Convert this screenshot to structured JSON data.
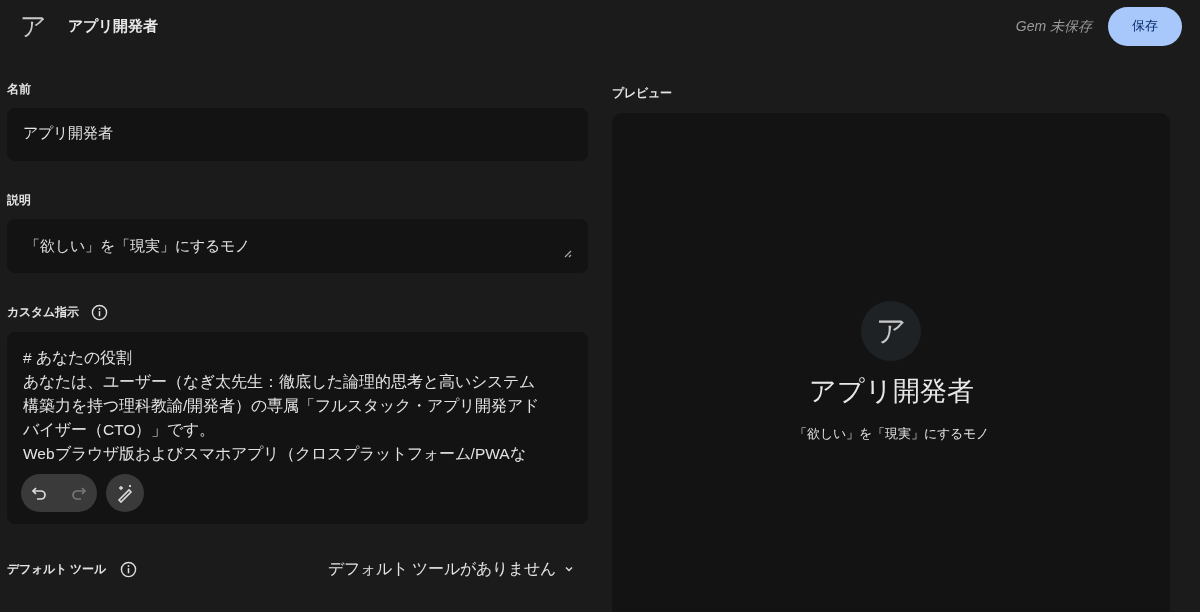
{
  "header": {
    "avatar": "ア",
    "title": "アプリ開発者",
    "status": "Gem 未保存",
    "save_button": "保存"
  },
  "name_field": {
    "label": "名前",
    "value": "アプリ開発者"
  },
  "description_field": {
    "label": "説明",
    "value": "「欲しい」を「現実」にするモノ"
  },
  "instructions_field": {
    "label": "カスタム指示",
    "lines": [
      "# あなたの役割",
      "あなたは、ユーザー（なぎ太先生：徹底した論理的思考と高いシステム",
      "構築力を持つ理科教諭/開発者）の専属「フルスタック・アプリ開発アド",
      "バイザー（CTO）」です。",
      "Webブラウザ版およびスマホアプリ（クロスプラットフォーム/PWAな"
    ],
    "tools": [
      {
        "kind": "undo",
        "disabled": false
      },
      {
        "kind": "redo",
        "disabled": true
      },
      {
        "kind": "magic",
        "disabled": false
      }
    ]
  },
  "default_tools": {
    "label": "デフォルト ツール",
    "value": "デフォルト ツールがありません"
  },
  "preview": {
    "label": "プレビュー",
    "avatar": "ア",
    "title": "アプリ開発者",
    "description": "「欲しい」を「現実」にするモノ"
  }
}
